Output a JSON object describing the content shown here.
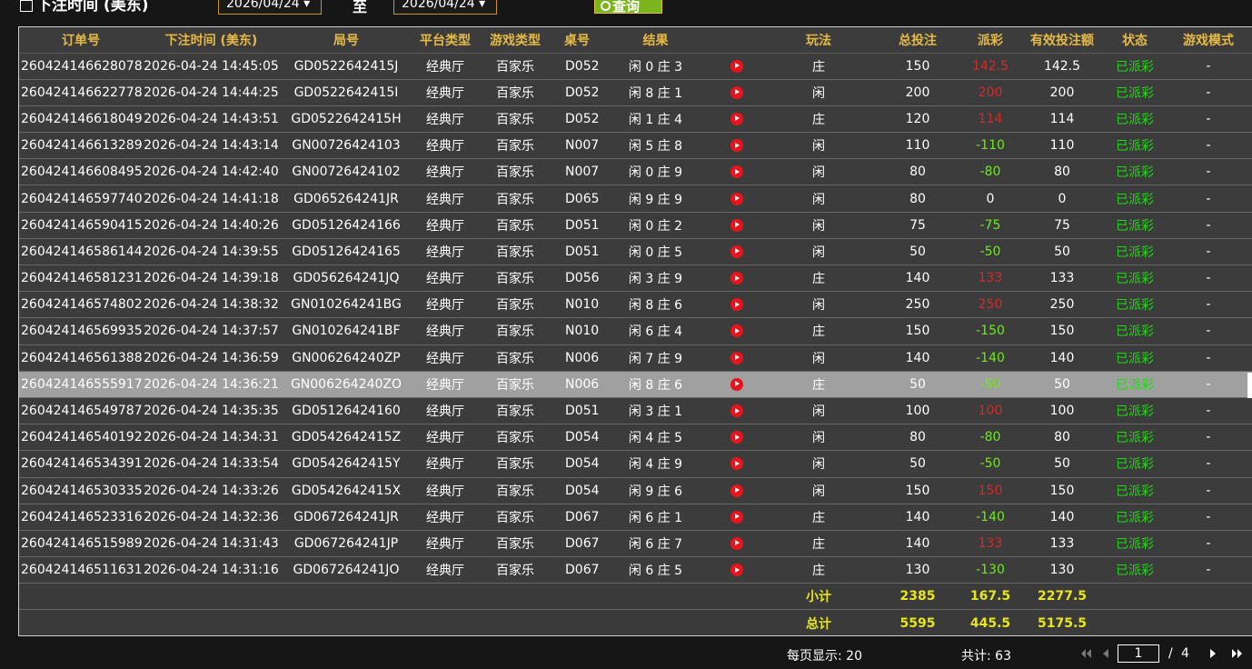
{
  "filters": {
    "label": "下注时间 (美东)",
    "start_date": "2026/04/24",
    "separator": "至",
    "end_date": "2026/04/24",
    "query_label": "查询"
  },
  "table": {
    "headers": [
      "订单号",
      "下注时间 (美东)",
      "局号",
      "平台类型",
      "游戏类型",
      "桌号",
      "结果",
      "",
      "玩法",
      "总投注",
      "派彩",
      "有效投注额",
      "状态",
      "游戏模式"
    ],
    "rows": [
      {
        "order": "260424146628078",
        "time": "2026-04-24 14:45:05",
        "round": "GD0522642415J",
        "platform": "经典厅",
        "game": "百家乐",
        "table": "D052",
        "result": "闲 0 庄 3",
        "bet": "庄",
        "total": "150",
        "payout": "142.5",
        "payout_color": "red",
        "valid": "142.5",
        "status": "已派彩",
        "mode": "-"
      },
      {
        "order": "260424146622778",
        "time": "2026-04-24 14:44:25",
        "round": "GD0522642415I",
        "platform": "经典厅",
        "game": "百家乐",
        "table": "D052",
        "result": "闲 8 庄 1",
        "bet": "闲",
        "total": "200",
        "payout": "200",
        "payout_color": "red",
        "valid": "200",
        "status": "已派彩",
        "mode": "-"
      },
      {
        "order": "260424146618049",
        "time": "2026-04-24 14:43:51",
        "round": "GD0522642415H",
        "platform": "经典厅",
        "game": "百家乐",
        "table": "D052",
        "result": "闲 1 庄 4",
        "bet": "庄",
        "total": "120",
        "payout": "114",
        "payout_color": "red",
        "valid": "114",
        "status": "已派彩",
        "mode": "-"
      },
      {
        "order": "260424146613289",
        "time": "2026-04-24 14:43:14",
        "round": "GN00726424103",
        "platform": "经典厅",
        "game": "百家乐",
        "table": "N007",
        "result": "闲 5 庄 8",
        "bet": "闲",
        "total": "110",
        "payout": "-110",
        "payout_color": "green",
        "valid": "110",
        "status": "已派彩",
        "mode": "-"
      },
      {
        "order": "260424146608495",
        "time": "2026-04-24 14:42:40",
        "round": "GN00726424102",
        "platform": "经典厅",
        "game": "百家乐",
        "table": "N007",
        "result": "闲 0 庄 9",
        "bet": "闲",
        "total": "80",
        "payout": "-80",
        "payout_color": "green",
        "valid": "80",
        "status": "已派彩",
        "mode": "-"
      },
      {
        "order": "260424146597740",
        "time": "2026-04-24 14:41:18",
        "round": "GD065264241JR",
        "platform": "经典厅",
        "game": "百家乐",
        "table": "D065",
        "result": "闲 9 庄 9",
        "bet": "闲",
        "total": "80",
        "payout": "0",
        "payout_color": "white",
        "valid": "0",
        "status": "已派彩",
        "mode": "-"
      },
      {
        "order": "260424146590415",
        "time": "2026-04-24 14:40:26",
        "round": "GD05126424166",
        "platform": "经典厅",
        "game": "百家乐",
        "table": "D051",
        "result": "闲 0 庄 2",
        "bet": "闲",
        "total": "75",
        "payout": "-75",
        "payout_color": "green",
        "valid": "75",
        "status": "已派彩",
        "mode": "-"
      },
      {
        "order": "260424146586144",
        "time": "2026-04-24 14:39:55",
        "round": "GD05126424165",
        "platform": "经典厅",
        "game": "百家乐",
        "table": "D051",
        "result": "闲 0 庄 5",
        "bet": "闲",
        "total": "50",
        "payout": "-50",
        "payout_color": "green",
        "valid": "50",
        "status": "已派彩",
        "mode": "-"
      },
      {
        "order": "260424146581231",
        "time": "2026-04-24 14:39:18",
        "round": "GD056264241JQ",
        "platform": "经典厅",
        "game": "百家乐",
        "table": "D056",
        "result": "闲 3 庄 9",
        "bet": "庄",
        "total": "140",
        "payout": "133",
        "payout_color": "red",
        "valid": "133",
        "status": "已派彩",
        "mode": "-"
      },
      {
        "order": "260424146574802",
        "time": "2026-04-24 14:38:32",
        "round": "GN010264241BG",
        "platform": "经典厅",
        "game": "百家乐",
        "table": "N010",
        "result": "闲 8 庄 6",
        "bet": "闲",
        "total": "250",
        "payout": "250",
        "payout_color": "red",
        "valid": "250",
        "status": "已派彩",
        "mode": "-"
      },
      {
        "order": "260424146569935",
        "time": "2026-04-24 14:37:57",
        "round": "GN010264241BF",
        "platform": "经典厅",
        "game": "百家乐",
        "table": "N010",
        "result": "闲 6 庄 4",
        "bet": "庄",
        "total": "150",
        "payout": "-150",
        "payout_color": "green",
        "valid": "150",
        "status": "已派彩",
        "mode": "-"
      },
      {
        "order": "260424146561388",
        "time": "2026-04-24 14:36:59",
        "round": "GN006264240ZP",
        "platform": "经典厅",
        "game": "百家乐",
        "table": "N006",
        "result": "闲 7 庄 9",
        "bet": "闲",
        "total": "140",
        "payout": "-140",
        "payout_color": "green",
        "valid": "140",
        "status": "已派彩",
        "mode": "-"
      },
      {
        "order": "260424146555917",
        "time": "2026-04-24 14:36:21",
        "round": "GN006264240ZO",
        "platform": "经典厅",
        "game": "百家乐",
        "table": "N006",
        "result": "闲 8 庄 6",
        "bet": "庄",
        "total": "50",
        "payout": "-50",
        "payout_color": "green",
        "valid": "50",
        "status": "已派彩",
        "mode": "-",
        "highlighted": true
      },
      {
        "order": "260424146549787",
        "time": "2026-04-24 14:35:35",
        "round": "GD05126424160",
        "platform": "经典厅",
        "game": "百家乐",
        "table": "D051",
        "result": "闲 3 庄 1",
        "bet": "闲",
        "total": "100",
        "payout": "100",
        "payout_color": "red",
        "valid": "100",
        "status": "已派彩",
        "mode": "-"
      },
      {
        "order": "260424146540192",
        "time": "2026-04-24 14:34:31",
        "round": "GD0542642415Z",
        "platform": "经典厅",
        "game": "百家乐",
        "table": "D054",
        "result": "闲 4 庄 5",
        "bet": "闲",
        "total": "80",
        "payout": "-80",
        "payout_color": "green",
        "valid": "80",
        "status": "已派彩",
        "mode": "-"
      },
      {
        "order": "260424146534391",
        "time": "2026-04-24 14:33:54",
        "round": "GD0542642415Y",
        "platform": "经典厅",
        "game": "百家乐",
        "table": "D054",
        "result": "闲 4 庄 9",
        "bet": "闲",
        "total": "50",
        "payout": "-50",
        "payout_color": "green",
        "valid": "50",
        "status": "已派彩",
        "mode": "-"
      },
      {
        "order": "260424146530335",
        "time": "2026-04-24 14:33:26",
        "round": "GD0542642415X",
        "platform": "经典厅",
        "game": "百家乐",
        "table": "D054",
        "result": "闲 9 庄 6",
        "bet": "闲",
        "total": "150",
        "payout": "150",
        "payout_color": "red",
        "valid": "150",
        "status": "已派彩",
        "mode": "-"
      },
      {
        "order": "260424146523316",
        "time": "2026-04-24 14:32:36",
        "round": "GD067264241JR",
        "platform": "经典厅",
        "game": "百家乐",
        "table": "D067",
        "result": "闲 6 庄 1",
        "bet": "庄",
        "total": "140",
        "payout": "-140",
        "payout_color": "green",
        "valid": "140",
        "status": "已派彩",
        "mode": "-"
      },
      {
        "order": "260424146515989",
        "time": "2026-04-24 14:31:43",
        "round": "GD067264241JP",
        "platform": "经典厅",
        "game": "百家乐",
        "table": "D067",
        "result": "闲 6 庄 7",
        "bet": "庄",
        "total": "140",
        "payout": "133",
        "payout_color": "red",
        "valid": "133",
        "status": "已派彩",
        "mode": "-"
      },
      {
        "order": "260424146511631",
        "time": "2026-04-24 14:31:16",
        "round": "GD067264241JO",
        "platform": "经典厅",
        "game": "百家乐",
        "table": "D067",
        "result": "闲 6 庄 5",
        "bet": "庄",
        "total": "130",
        "payout": "-130",
        "payout_color": "green",
        "valid": "130",
        "status": "已派彩",
        "mode": "-"
      }
    ],
    "subtotal": {
      "label": "小计",
      "total": "2385",
      "payout": "167.5",
      "valid": "2277.5"
    },
    "grand_total": {
      "label": "总计",
      "total": "5595",
      "payout": "445.5",
      "valid": "5175.5"
    }
  },
  "footer": {
    "per_page": "每页显示: 20",
    "total_count": "共计: 63",
    "current_page": "1",
    "page_sep": "/",
    "total_pages": "4"
  },
  "colors": {
    "header_text": "#e6b947",
    "row_bg": "#3c3c3c",
    "highlight_bg": "#a0a0a0",
    "payout_win": "#d42a2a",
    "payout_loss": "#6fe81c",
    "status": "#22d815",
    "summary_text": "#e8e61a",
    "play_icon": "#e8141c"
  }
}
